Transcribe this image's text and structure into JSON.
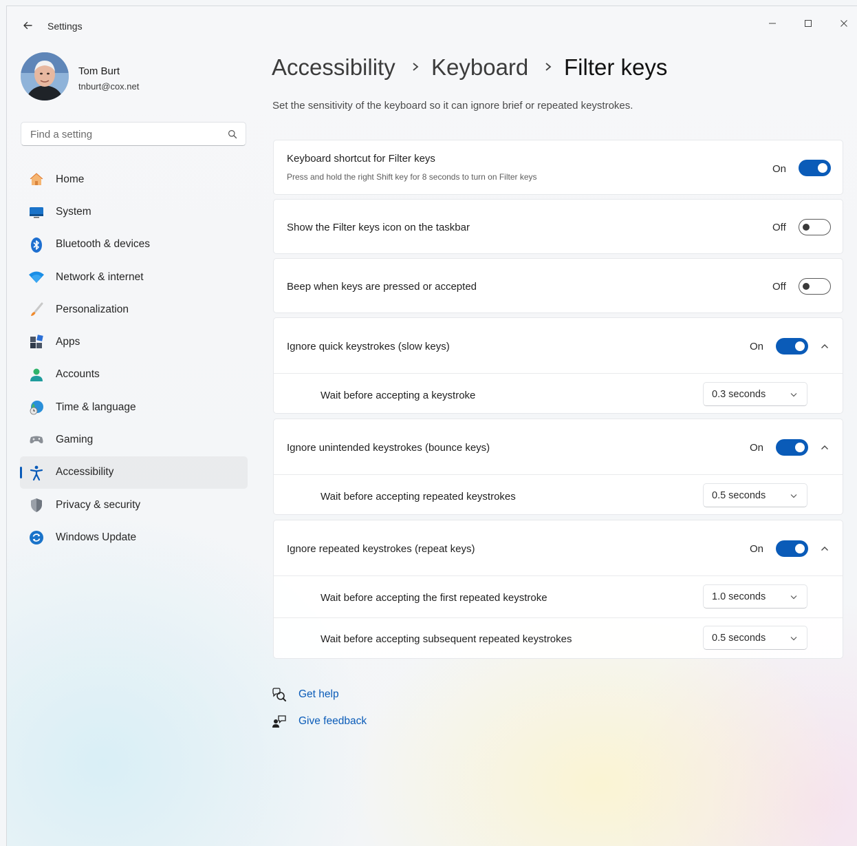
{
  "window": {
    "app_title": "Settings"
  },
  "user": {
    "name": "Tom Burt",
    "email": "tnburt@cox.net"
  },
  "search": {
    "placeholder": "Find a setting"
  },
  "sidebar": {
    "items": [
      {
        "label": "Home",
        "icon": "home-icon"
      },
      {
        "label": "System",
        "icon": "system-icon"
      },
      {
        "label": "Bluetooth & devices",
        "icon": "bluetooth-icon"
      },
      {
        "label": "Network & internet",
        "icon": "network-icon"
      },
      {
        "label": "Personalization",
        "icon": "brush-icon"
      },
      {
        "label": "Apps",
        "icon": "apps-icon"
      },
      {
        "label": "Accounts",
        "icon": "accounts-icon"
      },
      {
        "label": "Time & language",
        "icon": "globe-clock-icon"
      },
      {
        "label": "Gaming",
        "icon": "gamepad-icon"
      },
      {
        "label": "Accessibility",
        "icon": "accessibility-icon",
        "selected": true
      },
      {
        "label": "Privacy & security",
        "icon": "shield-icon"
      },
      {
        "label": "Windows Update",
        "icon": "update-icon"
      }
    ]
  },
  "breadcrumb": [
    "Accessibility",
    "Keyboard",
    "Filter keys"
  ],
  "description": "Set the sensitivity of the keyboard so it can ignore brief or repeated keystrokes.",
  "settings": {
    "shortcut": {
      "title": "Keyboard shortcut for Filter keys",
      "subtitle": "Press and hold the right Shift key for 8 seconds to turn on Filter keys",
      "state": "On"
    },
    "taskbar_icon": {
      "title": "Show the Filter keys icon on the taskbar",
      "state": "Off"
    },
    "beep": {
      "title": "Beep when keys are pressed or accepted",
      "state": "Off"
    },
    "slow_keys": {
      "title": "Ignore quick keystrokes (slow keys)",
      "state": "On",
      "sub": {
        "title": "Wait before accepting a keystroke",
        "value": "0.3 seconds"
      }
    },
    "bounce_keys": {
      "title": "Ignore unintended keystrokes (bounce keys)",
      "state": "On",
      "sub": {
        "title": "Wait before accepting repeated keystrokes",
        "value": "0.5 seconds"
      }
    },
    "repeat_keys": {
      "title": "Ignore repeated keystrokes (repeat keys)",
      "state": "On",
      "sub1": {
        "title": "Wait before accepting the first repeated keystroke",
        "value": "1.0 seconds"
      },
      "sub2": {
        "title": "Wait before accepting subsequent repeated keystrokes",
        "value": "0.5 seconds"
      }
    }
  },
  "links": {
    "help": "Get help",
    "feedback": "Give feedback"
  },
  "colors": {
    "accent": "#0a5bb8"
  }
}
